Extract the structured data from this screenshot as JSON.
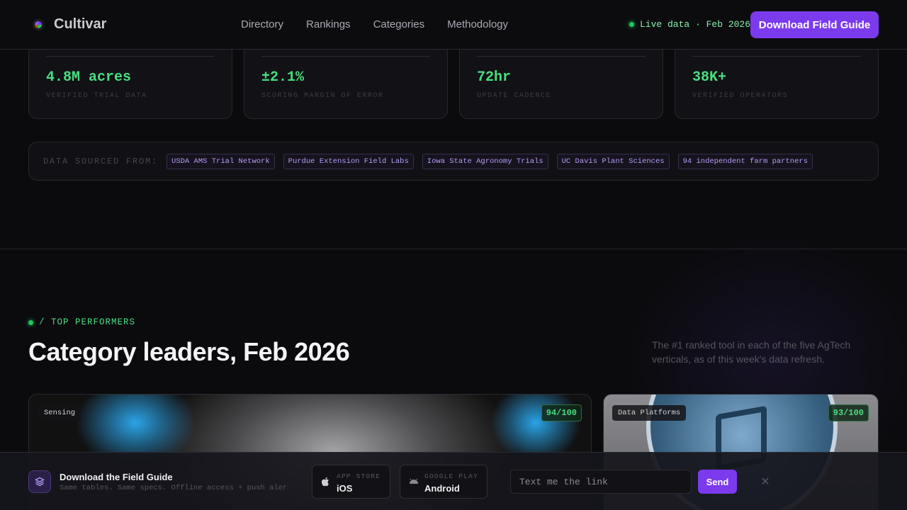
{
  "brand": {
    "name": "Cultivar"
  },
  "nav": {
    "links": [
      "Directory",
      "Rankings",
      "Categories",
      "Methodology"
    ]
  },
  "status": {
    "live_text": "Live data · Feb 2026"
  },
  "cta": {
    "label": "Download Field Guide"
  },
  "stats": [
    {
      "value": "4.8M acres",
      "label": "VERIFIED TRIAL DATA"
    },
    {
      "value": "±2.1%",
      "label": "SCORING MARGIN OF ERROR"
    },
    {
      "value": "72hr",
      "label": "UPDATE CADENCE"
    },
    {
      "value": "38K+",
      "label": "VERIFIED OPERATORS"
    }
  ],
  "sources": {
    "label": "DATA SOURCED FROM:",
    "items": [
      "USDA AMS Trial Network",
      "Purdue Extension Field Labs",
      "Iowa State Agronomy Trials",
      "UC Davis Plant Sciences",
      "94 independent farm partners"
    ]
  },
  "section": {
    "eyebrow": "/ TOP PERFORMERS",
    "title": "Category leaders, Feb 2026",
    "description": "The #1 ranked tool in each of the five AgTech verticals, as of this week's data refresh."
  },
  "leaders": [
    {
      "category": "Sensing",
      "score": "94/100"
    },
    {
      "category": "Data Platforms",
      "score": "93/100"
    }
  ],
  "download_bar": {
    "title": "Download the Field Guide",
    "subtitle": "Same tables. Same specs. Offline access + push alerts.",
    "ios": {
      "small": "APP STORE",
      "big": "iOS"
    },
    "android": {
      "small": "GOOGLE PLAY",
      "big": "Android"
    },
    "input_placeholder": "Text me the link",
    "send_label": "Send",
    "close_symbol": "✕"
  },
  "colors": {
    "accent": "#7c3aed",
    "positive": "#4ade80",
    "background": "#0b0b0e"
  },
  "icons": [
    "brand-logo-icon",
    "layers-icon",
    "apple-icon",
    "android-icon",
    "close-icon"
  ]
}
